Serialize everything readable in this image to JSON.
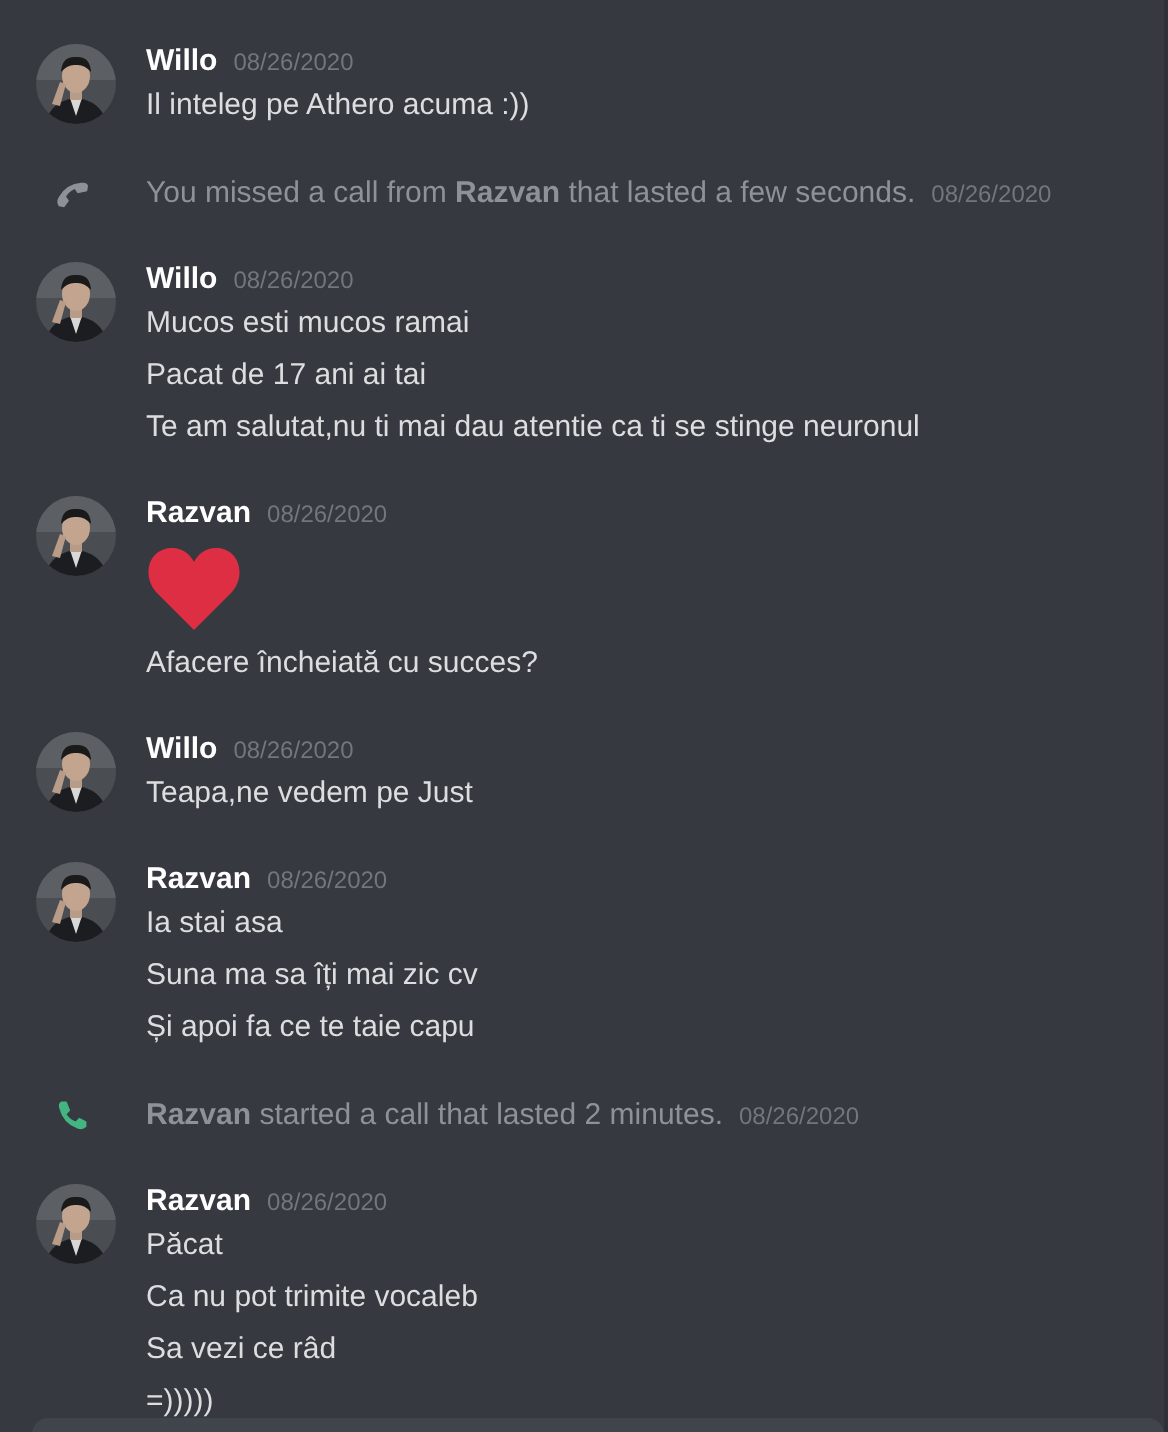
{
  "messages": [
    {
      "kind": "message",
      "author": "Willo",
      "timestamp": "08/26/2020",
      "avatar": {
        "kind": "picture"
      },
      "content": [
        {
          "kind": "text",
          "text": "Il inteleg pe Athero acuma :))"
        }
      ]
    },
    {
      "kind": "call",
      "missed": true,
      "text": "You missed a call from **Razvan** that lasted a few seconds.",
      "timestamp": "08/26/2020"
    },
    {
      "kind": "message",
      "author": "Willo",
      "timestamp": "08/26/2020",
      "avatar": {
        "kind": "picture"
      },
      "content": [
        {
          "kind": "text",
          "text": "Mucos esti mucos ramai"
        },
        {
          "kind": "text",
          "text": "Pacat de 17 ani ai tai"
        },
        {
          "kind": "text",
          "text": "Te am salutat,nu ti mai dau atentie ca ti se stinge neuronul"
        }
      ]
    },
    {
      "kind": "message",
      "author": "Razvan",
      "timestamp": "08/26/2020",
      "avatar": {
        "kind": "picture"
      },
      "content": [
        {
          "kind": "emoji"
        },
        {
          "kind": "text",
          "text": "Afacere încheiată cu succes?"
        }
      ]
    },
    {
      "kind": "message",
      "author": "Willo",
      "timestamp": "08/26/2020",
      "avatar": {
        "kind": "picture"
      },
      "content": [
        {
          "kind": "text",
          "text": "Teapa,ne vedem pe Just"
        }
      ]
    },
    {
      "kind": "message",
      "author": "Razvan",
      "timestamp": "08/26/2020",
      "avatar": {
        "kind": "picture"
      },
      "content": [
        {
          "kind": "text",
          "text": "Ia stai asa"
        },
        {
          "kind": "text",
          "text": "Suna ma sa îți mai zic cv"
        },
        {
          "kind": "text",
          "text": "Și apoi fa ce te taie capu"
        }
      ]
    },
    {
      "kind": "call",
      "missed": false,
      "text": "**Razvan** started a call that lasted 2 minutes.",
      "timestamp": "08/26/2020"
    },
    {
      "kind": "message",
      "author": "Razvan",
      "timestamp": "08/26/2020",
      "avatar": {
        "kind": "picture"
      },
      "content": [
        {
          "kind": "text",
          "text": "Păcat"
        },
        {
          "kind": "text",
          "text": "Ca nu pot trimite vocaleb"
        },
        {
          "kind": "text",
          "text": "Sa vezi ce râd"
        },
        {
          "kind": "text",
          "text": "=)))))"
        }
      ]
    }
  ],
  "composer": {
    "kind": "field"
  }
}
